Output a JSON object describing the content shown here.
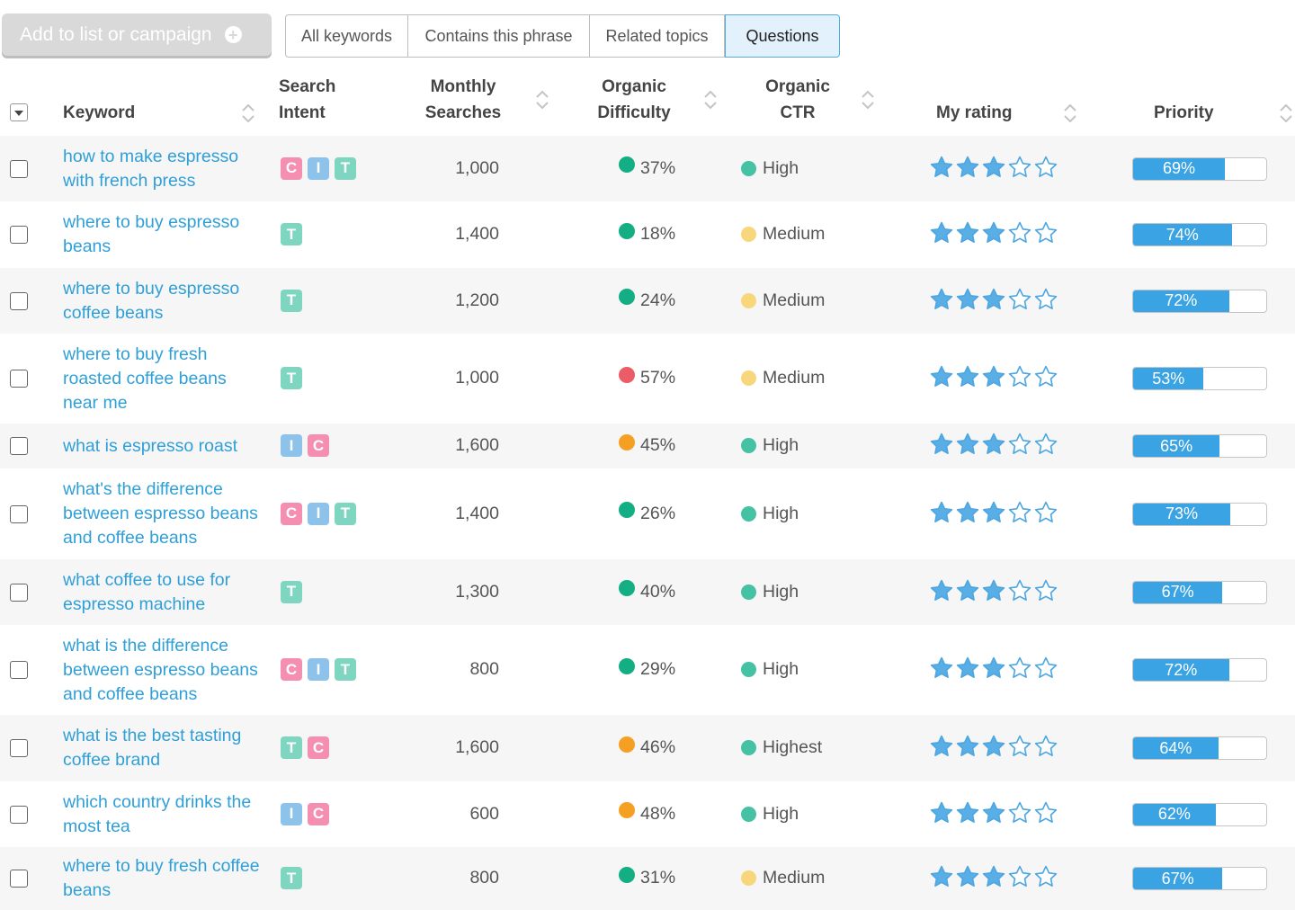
{
  "toolbar": {
    "add_button_label": "Add to list or campaign",
    "tabs": [
      "All keywords",
      "Contains this phrase",
      "Related topics",
      "Questions"
    ],
    "active_tab": "Questions"
  },
  "table": {
    "headers": {
      "keyword": "Keyword",
      "search_intent_1": "Search",
      "search_intent_2": "Intent",
      "monthly_1": "Monthly",
      "monthly_2": "Searches",
      "difficulty_1": "Organic",
      "difficulty_2": "Difficulty",
      "ctr_1": "Organic",
      "ctr_2": "CTR",
      "rating": "My rating",
      "priority": "Priority"
    },
    "intent_colors": {
      "C": "#f48fb1",
      "I": "#8dc3ea",
      "T": "#7fd6c0"
    },
    "difficulty_colors": {
      "green": "#14ae84",
      "orange": "#f5a022",
      "red": "#ec5c66"
    },
    "ctr_colors": {
      "High": "#45c1a3",
      "Highest": "#45c1a3",
      "Medium": "#f8d77c"
    },
    "rows": [
      {
        "keyword": "how to make espresso with french press",
        "intent": [
          "C",
          "I",
          "T"
        ],
        "monthly": "1,000",
        "difficulty": "37%",
        "difficulty_level": "green",
        "ctr": "High",
        "rating": 3,
        "priority": 69
      },
      {
        "keyword": "where to buy espresso beans",
        "intent": [
          "T"
        ],
        "monthly": "1,400",
        "difficulty": "18%",
        "difficulty_level": "green",
        "ctr": "Medium",
        "rating": 3,
        "priority": 74
      },
      {
        "keyword": "where to buy espresso coffee beans",
        "intent": [
          "T"
        ],
        "monthly": "1,200",
        "difficulty": "24%",
        "difficulty_level": "green",
        "ctr": "Medium",
        "rating": 3,
        "priority": 72
      },
      {
        "keyword": "where to buy fresh roasted coffee beans near me",
        "intent": [
          "T"
        ],
        "monthly": "1,000",
        "difficulty": "57%",
        "difficulty_level": "red",
        "ctr": "Medium",
        "rating": 3,
        "priority": 53
      },
      {
        "keyword": "what is espresso roast",
        "intent": [
          "I",
          "C"
        ],
        "monthly": "1,600",
        "difficulty": "45%",
        "difficulty_level": "orange",
        "ctr": "High",
        "rating": 3,
        "priority": 65
      },
      {
        "keyword": "what's the difference between espresso beans and coffee beans",
        "intent": [
          "C",
          "I",
          "T"
        ],
        "monthly": "1,400",
        "difficulty": "26%",
        "difficulty_level": "green",
        "ctr": "High",
        "rating": 3,
        "priority": 73
      },
      {
        "keyword": "what coffee to use for espresso machine",
        "intent": [
          "T"
        ],
        "monthly": "1,300",
        "difficulty": "40%",
        "difficulty_level": "green",
        "ctr": "High",
        "rating": 3,
        "priority": 67
      },
      {
        "keyword": "what is the difference between espresso beans and coffee beans",
        "intent": [
          "C",
          "I",
          "T"
        ],
        "monthly": "800",
        "difficulty": "29%",
        "difficulty_level": "green",
        "ctr": "High",
        "rating": 3,
        "priority": 72
      },
      {
        "keyword": "what is the best tasting coffee brand",
        "intent": [
          "T",
          "C"
        ],
        "monthly": "1,600",
        "difficulty": "46%",
        "difficulty_level": "orange",
        "ctr": "Highest",
        "rating": 3,
        "priority": 64
      },
      {
        "keyword": "which country drinks the most tea",
        "intent": [
          "I",
          "C"
        ],
        "monthly": "600",
        "difficulty": "48%",
        "difficulty_level": "orange",
        "ctr": "High",
        "rating": 3,
        "priority": 62
      },
      {
        "keyword": "where to buy fresh coffee beans",
        "intent": [
          "T"
        ],
        "monthly": "800",
        "difficulty": "31%",
        "difficulty_level": "green",
        "ctr": "Medium",
        "rating": 3,
        "priority": 67
      }
    ]
  }
}
